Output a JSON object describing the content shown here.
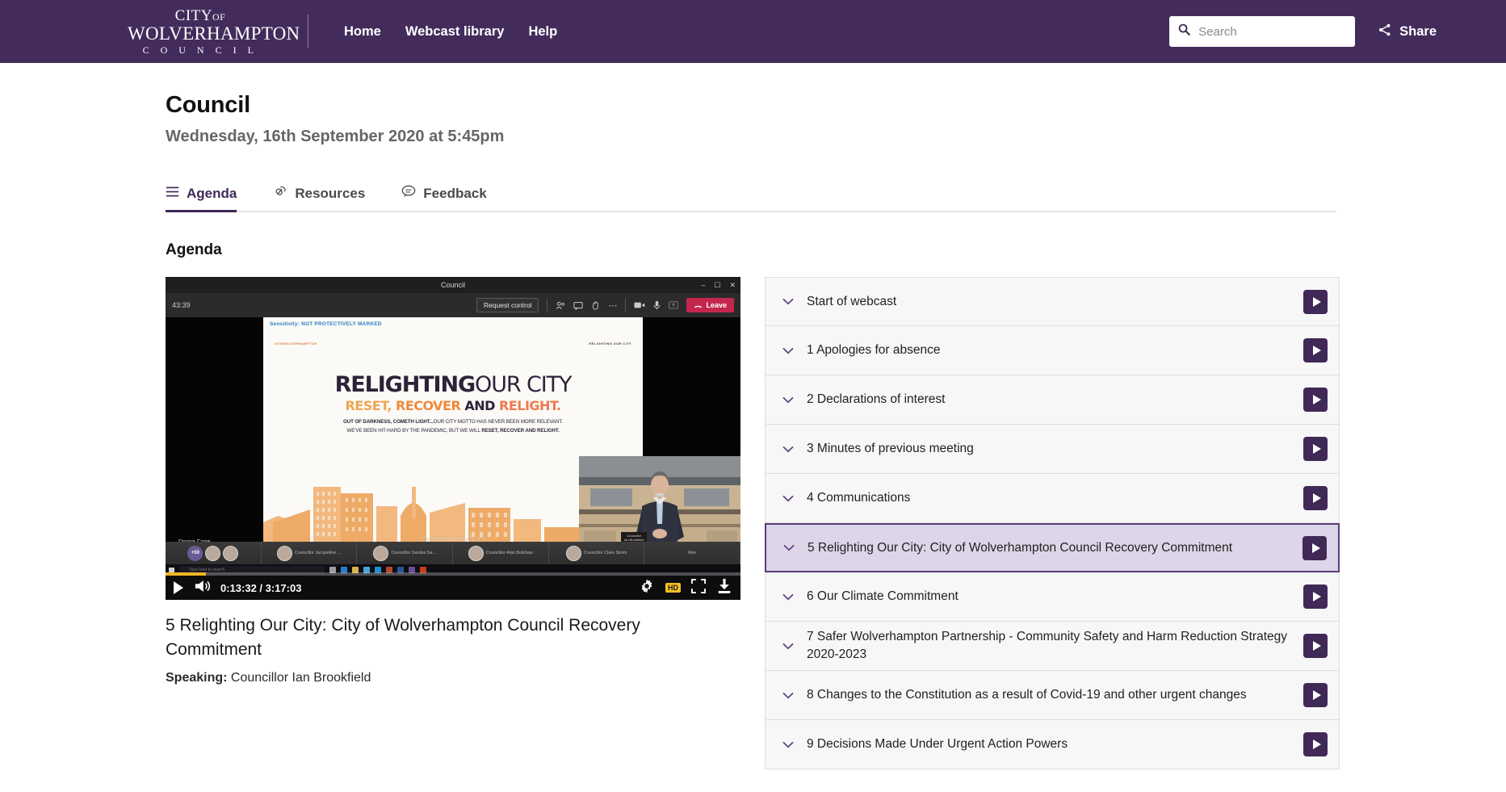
{
  "header": {
    "logo": {
      "line1": "CITY",
      "line1_small": "OF",
      "line2": "WOLVERHAMPTON",
      "line3": "C O U N C I L"
    },
    "nav": [
      {
        "label": "Home",
        "name": "nav-home"
      },
      {
        "label": "Webcast library",
        "name": "nav-webcast-library"
      },
      {
        "label": "Help",
        "name": "nav-help"
      }
    ],
    "search": {
      "placeholder": "Search",
      "value": "",
      "icon": "search-icon"
    },
    "share": {
      "label": "Share",
      "icon": "share-icon"
    },
    "background_color": "#432c5c"
  },
  "page": {
    "title": "Council",
    "subtitle": "Wednesday, 16th September 2020 at 5:45pm"
  },
  "tabs": [
    {
      "label": "Agenda",
      "icon": "list-icon",
      "active": true
    },
    {
      "label": "Resources",
      "icon": "link-icon",
      "active": false
    },
    {
      "label": "Feedback",
      "icon": "comment-icon",
      "active": false
    }
  ],
  "section": {
    "title": "Agenda"
  },
  "player": {
    "current_time": "0:13:32",
    "duration": "3:17:03",
    "time_display": "0:13:32  /  3:17:03",
    "progress_percent": 7,
    "quality_badge": "HD",
    "controls": {
      "play": "play-icon",
      "volume": "volume-icon",
      "settings": "gear-icon",
      "fullscreen": "fullscreen-icon",
      "download": "download-icon"
    },
    "teams_window": {
      "title": "Council",
      "call_timer": "43:39",
      "request_control_label": "Request control",
      "leave_label": "Leave",
      "toolbar_icons": [
        "participants-icon",
        "chat-icon",
        "raise-hand-icon",
        "more-options-icon",
        "camera-icon",
        "microphone-icon",
        "share-screen-icon"
      ],
      "window_buttons": [
        "minimize-icon",
        "maximize-icon",
        "close-icon"
      ],
      "presenter_name": "Donna Cope",
      "overflow_badge": "+50",
      "participants": [
        "Councillor Jacqueline ...",
        "Councillor Sandra Sa...",
        "Councillor Alan Bolshaw",
        "Councillor Clare Simm",
        "Res"
      ],
      "taskbar_search_placeholder": "Type here to search"
    },
    "slide": {
      "sensitivity": "Sensitivity: NOT PROTECTIVELY MARKED",
      "brand_left": "#ITSWOLVERHAMPTON",
      "brand_right": "RELIGHTING OUR CITY",
      "heading_bold": "RELIGHTING",
      "heading_thin": "OUR CITY",
      "sub_a": "RESET,",
      "sub_b": "RECOVER",
      "sub_c": "AND",
      "sub_d": "RELIGHT.",
      "body_line1_bold": "OUT OF DARKNESS, COMETH LIGHT...",
      "body_line1_rest": "OUR CITY MOTTO HAS NEVER BEEN MORE RELEVANT.",
      "body_line2_rest": "WE'VE BEEN HIT-HARD BY THE PANDEMIC, BUT WE WILL ",
      "body_line2_bold": "RESET, RECOVER AND RELIGHT."
    },
    "speaker_nameplate": "Councillor\nIan Brookfield",
    "caption": {
      "title": "5 Relighting Our City: City of Wolverhampton Council Recovery Commitment",
      "speaking_label": "Speaking:",
      "speaking_name": "Councillor Ian Brookfield"
    }
  },
  "agenda": {
    "items": [
      {
        "label": "Start of webcast",
        "active": false
      },
      {
        "label": "1 Apologies for absence",
        "active": false
      },
      {
        "label": "2 Declarations of interest",
        "active": false
      },
      {
        "label": "3 Minutes of previous meeting",
        "active": false
      },
      {
        "label": "4 Communications",
        "active": false
      },
      {
        "label": "5 Relighting Our City: City of Wolverhampton Council Recovery Commitment",
        "active": true
      },
      {
        "label": "6 Our Climate Commitment",
        "active": false
      },
      {
        "label": "7 Safer Wolverhampton Partnership - Community Safety and Harm Reduction Strategy 2020-2023",
        "active": false
      },
      {
        "label": "8 Changes to the Constitution as a result of Covid-19 and other urgent changes",
        "active": false
      },
      {
        "label": "9 Decisions Made Under Urgent Action Powers",
        "active": false
      }
    ],
    "play_button_label": "play-icon",
    "chevron_icon": "chevron-down-icon"
  },
  "colors": {
    "brand_purple": "#432c5c",
    "accent_purple": "#402957",
    "active_row_bg": "#ddd5e8",
    "active_row_border": "#5b3d7a",
    "row_bg": "#f7f7f8",
    "progress_yellow": "#f0b429",
    "leave_red": "#c4264e"
  }
}
